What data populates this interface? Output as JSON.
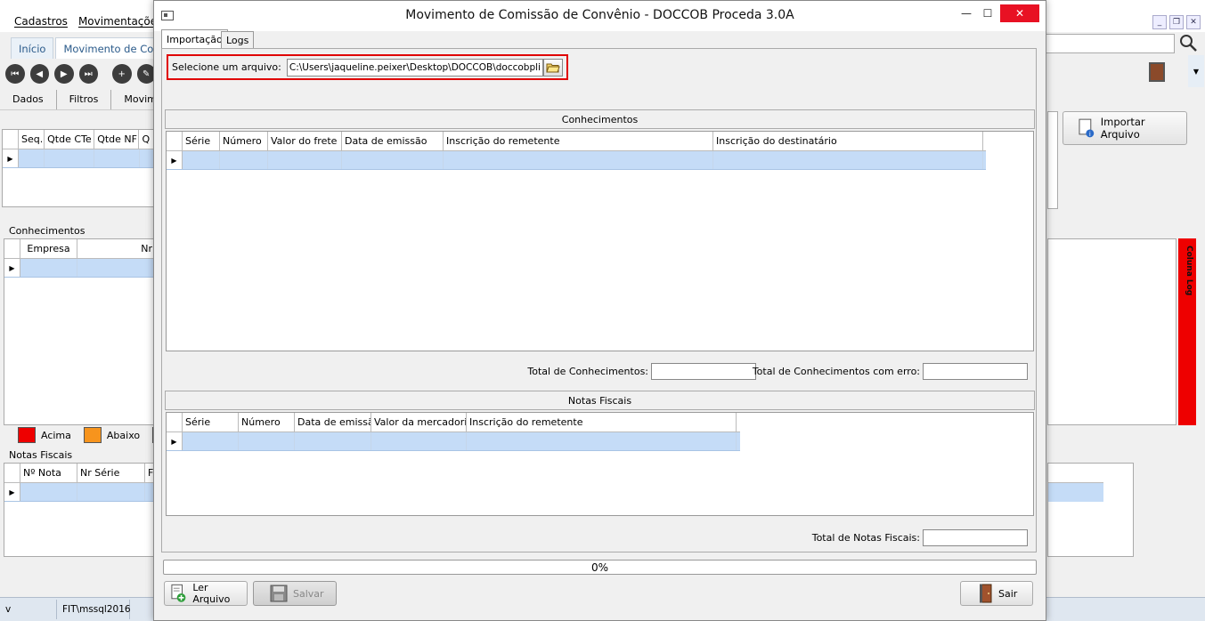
{
  "main_app": {
    "menu": [
      "Cadastros",
      "Movimentações"
    ],
    "tabs": [
      "Início",
      "Movimento de Comis"
    ],
    "subtabs": [
      "Dados",
      "Filtros",
      "Movime"
    ],
    "top_grid": {
      "columns": [
        "Seq.",
        "Qtde CTe",
        "Qtde NF",
        "Q"
      ]
    },
    "conhecimentos": {
      "title": "Conhecimentos",
      "columns": [
        "Empresa",
        "Nr"
      ]
    },
    "legend": [
      {
        "label": "Acima",
        "color": "#ee0000"
      },
      {
        "label": "Abaixo",
        "color": "#f7941d"
      },
      {
        "label": "",
        "color": "#1a8a1a"
      }
    ],
    "notas_fiscais": {
      "title": "Notas Fiscais",
      "columns": [
        "Nº Nota",
        "Nr Série",
        "F"
      ]
    },
    "importar_button": "Importar Arquivo",
    "coluna_log": "Coluna Log",
    "status": [
      "v",
      "FIT\\mssql2016"
    ]
  },
  "dialog": {
    "title": "Movimento de Comissão de Convênio - DOCCOB Proceda 3.0A",
    "tabs": [
      {
        "label": "Importação",
        "active": true
      },
      {
        "label": "Logs",
        "active": false
      }
    ],
    "file": {
      "label": "Selecione um arquivo:",
      "value": "C:\\Users\\jaqueline.peixer\\Desktop\\DOCCOB\\doccobplimor.t"
    },
    "conhecimentos": {
      "title": "Conhecimentos",
      "columns": [
        "Série",
        "Número",
        "Valor do frete",
        "Data de emissão",
        "Inscrição do remetente",
        "Inscrição do destinatário"
      ],
      "total_label": "Total de Conhecimentos:",
      "total_erro_label": "Total de Conhecimentos com erro:"
    },
    "notas_fiscais": {
      "title": "Notas Fiscais",
      "columns": [
        "Série",
        "Número",
        "Data de emissão",
        "Valor da mercadoria",
        "Inscrição do remetente"
      ],
      "total_label": "Total de Notas Fiscais:"
    },
    "progress": {
      "value": 0,
      "text": "0%"
    },
    "buttons": {
      "ler": "Ler Arquivo",
      "salvar": "Salvar",
      "sair": "Sair"
    }
  }
}
